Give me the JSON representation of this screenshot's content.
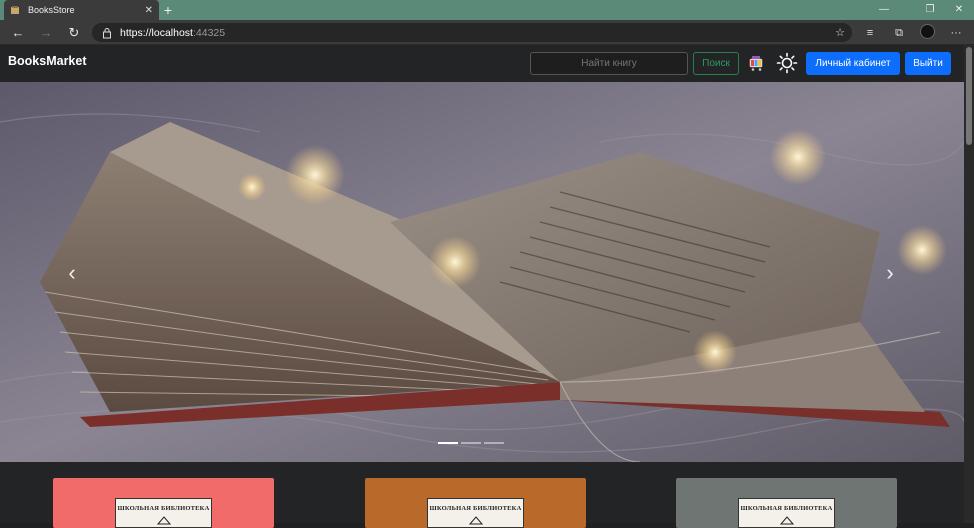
{
  "browser": {
    "tab_title": "BooksStore",
    "url_main": "https://localhost",
    "url_port": ":44325"
  },
  "site": {
    "brand": "BooksMarket",
    "search_placeholder": "Найти книгу",
    "search_button": "Поиск",
    "account_button": "Личный кабинет",
    "logout_button": "Выйти"
  },
  "carousel": {
    "prev_glyph": "‹",
    "next_glyph": "›",
    "active_index": 0,
    "indicator_count": 3
  },
  "books": [
    {
      "label": "ШКОЛЬНАЯ БИБЛИОТЕКА",
      "cover_color": "#f26b6b"
    },
    {
      "label": "ШКОЛЬНАЯ БИБЛИОТЕКА",
      "cover_color": "#b9692a"
    },
    {
      "label": "ШКОЛЬНАЯ БИБЛИОТЕКА",
      "cover_color": "#6f7573"
    }
  ],
  "colors": {
    "primary": "#0d6efd",
    "success": "#2e9d5f",
    "navbar": "#222425",
    "tabstrip": "#5b8a78"
  }
}
